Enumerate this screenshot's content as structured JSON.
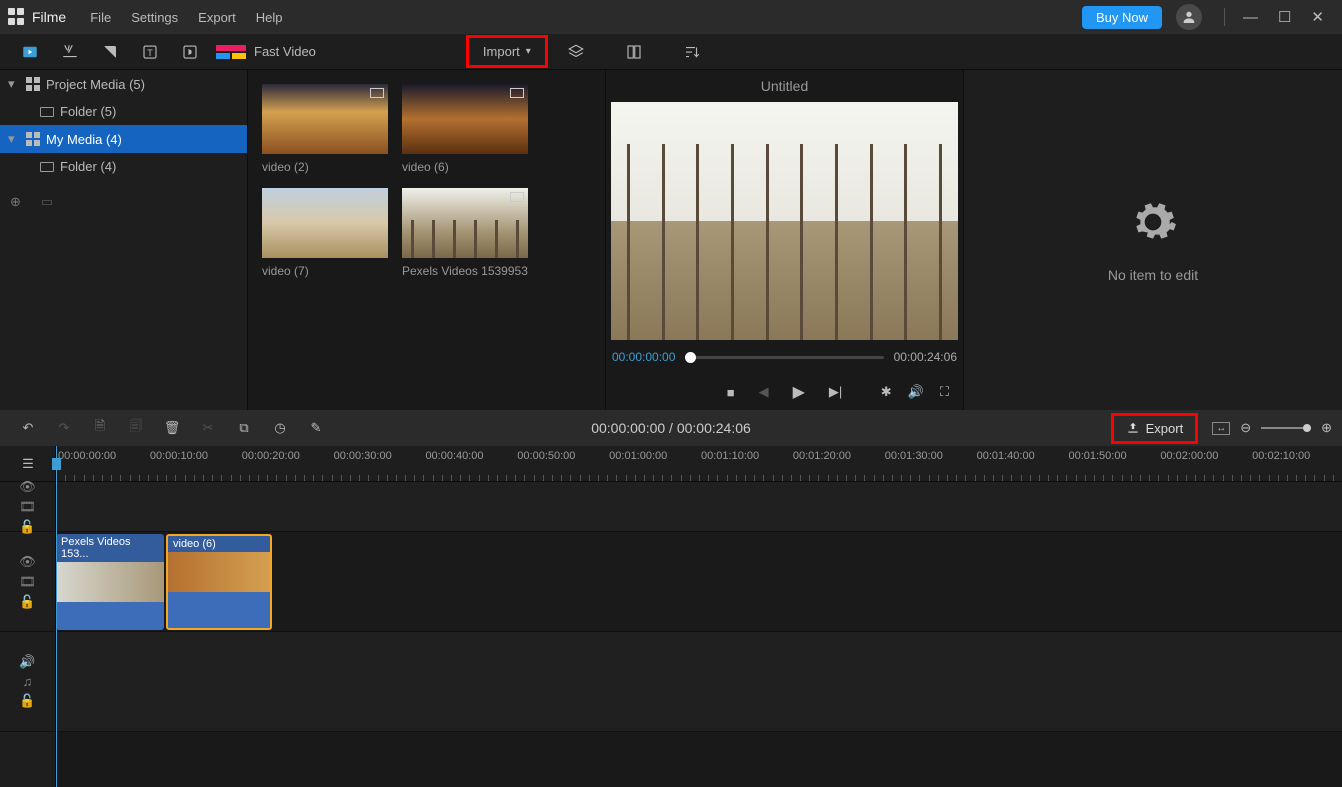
{
  "app": {
    "name": "Filme"
  },
  "menu": {
    "file": "File",
    "settings": "Settings",
    "export": "Export",
    "help": "Help"
  },
  "header": {
    "buy": "Buy Now"
  },
  "toolbar": {
    "fast_video": "Fast Video",
    "import": "Import"
  },
  "sidebar": {
    "items": [
      {
        "label": "Project Media (5)"
      },
      {
        "label": "Folder (5)"
      },
      {
        "label": "My Media (4)"
      },
      {
        "label": "Folder (4)"
      }
    ]
  },
  "media": [
    {
      "label": "video (2)"
    },
    {
      "label": "video (6)"
    },
    {
      "label": "video (7)"
    },
    {
      "label": "Pexels Videos 1539953"
    }
  ],
  "preview": {
    "title": "Untitled",
    "current": "00:00:00:00",
    "duration": "00:00:24:06"
  },
  "props": {
    "message": "No item to edit"
  },
  "editbar": {
    "time": "00:00:00:00 / 00:00:24:06",
    "export": "Export"
  },
  "ruler": [
    "00:00:00:00",
    "00:00:10:00",
    "00:00:20:00",
    "00:00:30:00",
    "00:00:40:00",
    "00:00:50:00",
    "00:01:00:00",
    "00:01:10:00",
    "00:01:20:00",
    "00:01:30:00",
    "00:01:40:00",
    "00:01:50:00",
    "00:02:00:00",
    "00:02:10:00"
  ],
  "clips": [
    {
      "label": "Pexels Videos 153..."
    },
    {
      "label": "video (6)"
    }
  ]
}
